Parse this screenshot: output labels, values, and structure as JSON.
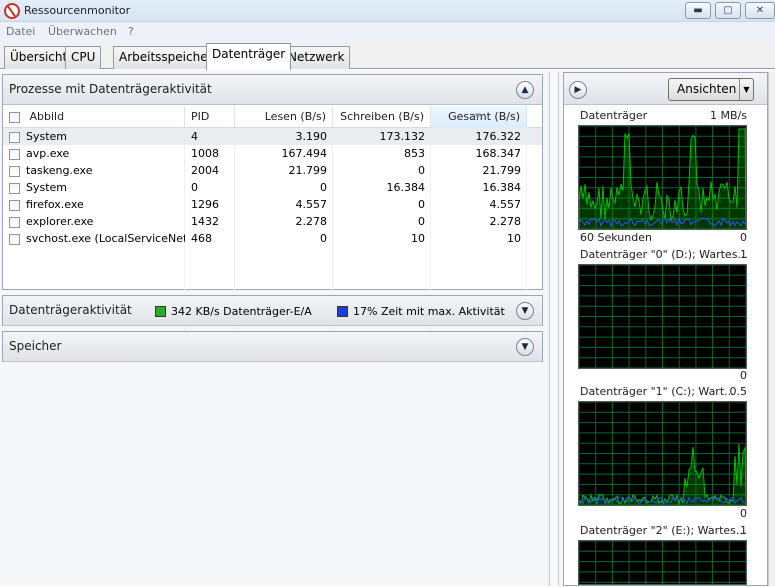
{
  "window": {
    "title": "Ressourcenmonitor",
    "minimize": "▬",
    "maximize": "▢",
    "close": "✕"
  },
  "menu": [
    "Datei",
    "Überwachen",
    "?"
  ],
  "tabs": [
    "Übersicht",
    "CPU",
    "Arbeitsspeicher",
    "Datenträger",
    "Netzwerk"
  ],
  "active_tab": "Datenträger",
  "processes": {
    "title": "Prozesse mit Datenträgeraktivität",
    "columns": [
      "Abbild",
      "PID",
      "Lesen (B/s)",
      "Schreiben (B/s)",
      "Gesamt (B/s)"
    ],
    "sorted_column": "Gesamt (B/s)",
    "rows": [
      {
        "image": "System",
        "pid": "4",
        "read": "3.190",
        "write": "173.132",
        "total": "176.322",
        "selected": true
      },
      {
        "image": "avp.exe",
        "pid": "1008",
        "read": "167.494",
        "write": "853",
        "total": "168.347"
      },
      {
        "image": "taskeng.exe",
        "pid": "2004",
        "read": "21.799",
        "write": "0",
        "total": "21.799"
      },
      {
        "image": "System",
        "pid": "0",
        "read": "0",
        "write": "16.384",
        "total": "16.384"
      },
      {
        "image": "firefox.exe",
        "pid": "1296",
        "read": "4.557",
        "write": "0",
        "total": "4.557"
      },
      {
        "image": "explorer.exe",
        "pid": "1432",
        "read": "2.278",
        "write": "0",
        "total": "2.278"
      },
      {
        "image": "svchost.exe (LocalServiceNet...",
        "pid": "468",
        "read": "0",
        "write": "10",
        "total": "10"
      }
    ]
  },
  "disk_activity": {
    "title": "Datenträgeraktivität",
    "io_label": "342 KB/s Datenträger-E/A",
    "io_color": "#2fa82f",
    "time_label": "17% Zeit mit max. Aktivität",
    "time_color": "#1a3fd6"
  },
  "storage": {
    "title": "Speicher"
  },
  "right_pane": {
    "views_label": "Ansichten",
    "graphs": [
      {
        "title": "Datenträger",
        "max": "1 MB/s",
        "footer_left": "60 Sekunden",
        "footer_right": "0"
      },
      {
        "title": "Datenträger \"0\" (D:); Wartes...",
        "max": "1",
        "footer_right": "0"
      },
      {
        "title": "Datenträger \"1\" (C:); Wart...",
        "max": "0.5",
        "footer_right": "0"
      },
      {
        "title": "Datenträger \"2\" (E:); Wartes...",
        "max": "1"
      }
    ]
  },
  "colors": {
    "graph_green": "#00c000",
    "graph_grid": "#006b2a",
    "graph_blue": "#2a54ff"
  }
}
